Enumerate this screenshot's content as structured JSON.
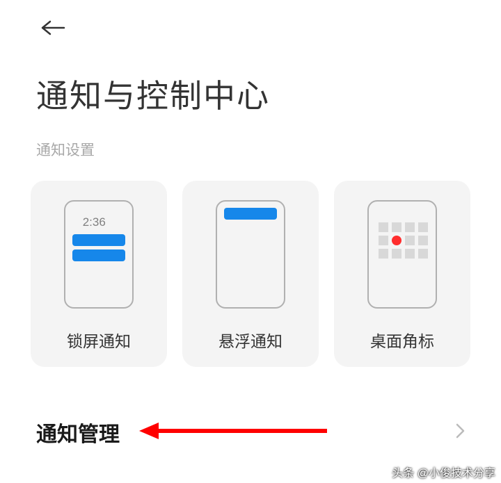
{
  "page": {
    "title": "通知与控制中心"
  },
  "section": {
    "label": "通知设置"
  },
  "cards": {
    "lock": {
      "label": "锁屏通知",
      "clock": "2:36"
    },
    "float": {
      "label": "悬浮通知"
    },
    "badge": {
      "label": "桌面角标"
    }
  },
  "list": {
    "manage": {
      "label": "通知管理"
    }
  },
  "watermark": "头条 @小俊技术分享"
}
